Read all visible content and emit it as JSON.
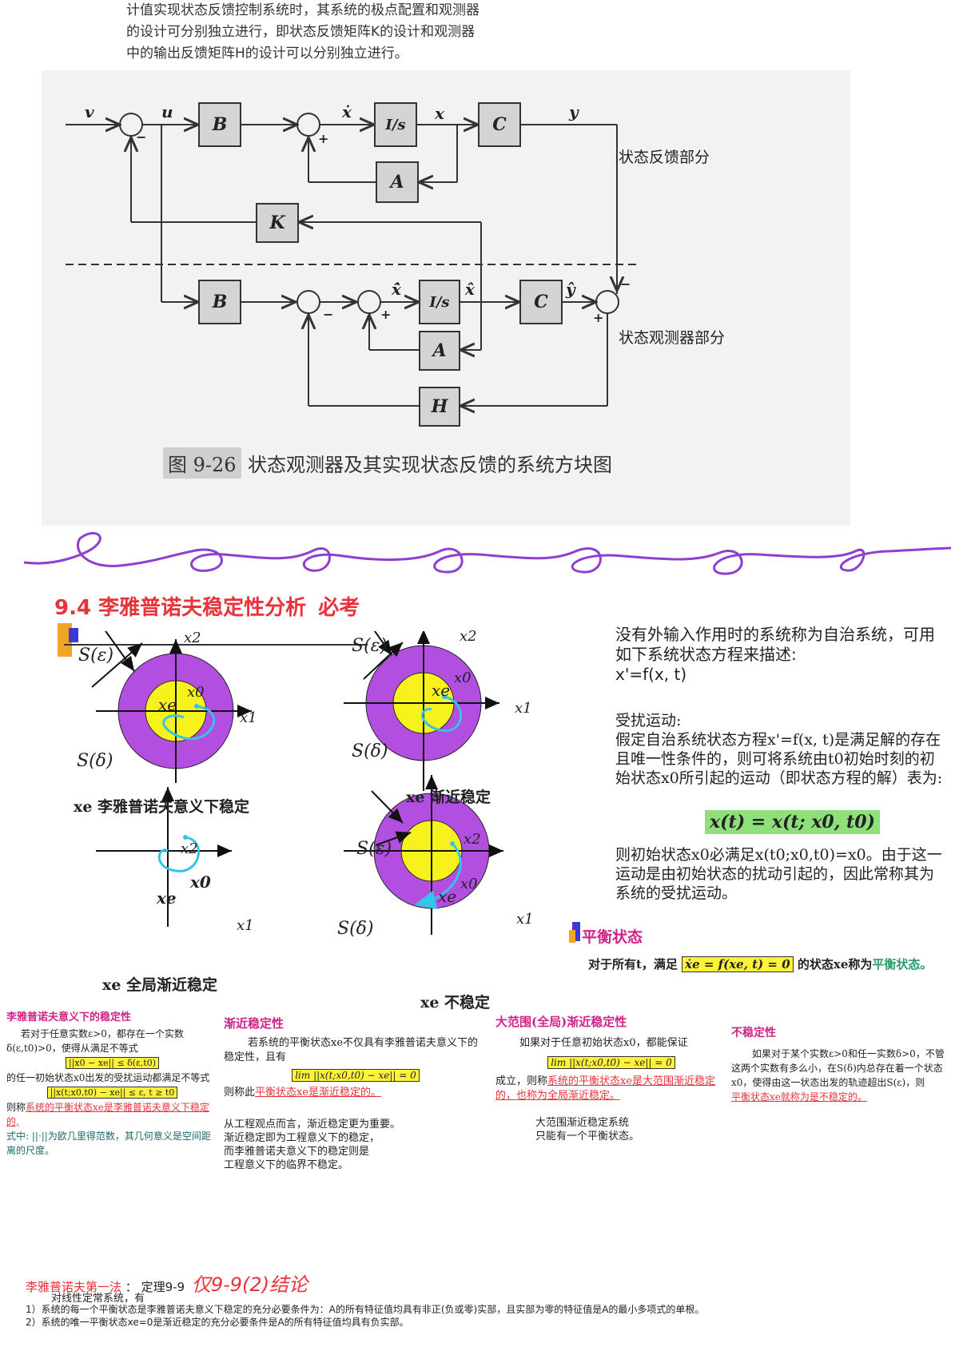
{
  "intro_lines": [
    "计值实现状态反馈控制系统时，其系统的极点配置和观测器",
    "的设计可分别独立进行，即状态反馈矩阵K的设计和观测器",
    "中的输出反馈矩阵H的设计可以分别独立进行。"
  ],
  "diagram": {
    "blocks": {
      "B1": "B",
      "I1": "I/s",
      "C1": "C",
      "A1": "A",
      "K": "K",
      "B2": "B",
      "I2": "I/s",
      "C2": "C",
      "A2": "A",
      "H": "H"
    },
    "signals": {
      "v": "v",
      "u": "u",
      "xdot": "ẋ",
      "x": "x",
      "y": "y",
      "xhatdot": "x̂̇",
      "xhat": "x̂",
      "yhat": "ŷ"
    },
    "signs": {
      "minus": "−",
      "plus": "+"
    },
    "region_feedback": "状态反馈部分",
    "region_observer": "状态观测器部分",
    "caption_num": "图 9-26",
    "caption_text": "状态观测器及其实现状态反馈的系统方块图"
  },
  "section_title": "9.4 李雅普诺夫稳定性分析",
  "section_note": "必考",
  "plots": {
    "s_eps": "S(ε)",
    "s_delta": "S(δ)",
    "x1": "x1",
    "x2": "x2",
    "xe": "xe",
    "x0": "x0",
    "cap1": "xe 李雅普诺夫意义下稳定",
    "cap2": "xe 渐近稳定",
    "cap3": "xe 全局渐近稳定",
    "cap4": "xe 不稳定"
  },
  "right_text": {
    "p1": "没有外输入作用时的系统称为自治系统，可用如下系统状态方程来描述:",
    "eq1": "x'=f(x, t)",
    "p2_title": "受扰运动:",
    "p2": "假定自治系统状态方程x'=f(x, t)是满足解的存在且唯一性条件的，则可将系统由t0初始时刻的初始状态x0所引起的运动（即状态方程的解）表为:",
    "eq2": "x(t) = x(t; x0, t0)",
    "p3": "则初始状态x0必满足x(t0;x0,t0)=x0。由于这一运动是由初始状态的扰动引起的，因此常称其为系统的受扰运动。"
  },
  "equilibrium": {
    "title": "平衡状态",
    "pre": "对于所有t，满足",
    "eq": "ẋe = f(xe, t) = 0",
    "post": "的状态xe称为",
    "term": "平衡状态。"
  },
  "boxes": {
    "b1_title": "李雅普诺夫意义下的稳定性",
    "b1_l1": "若对于任意实数ε>0，都存在一个实数δ(ε,t0)>0，使得从满足不等式",
    "b1_eq1": "||x0 − xe|| ≤ δ(ε,t0)",
    "b1_l2": "的任一初始状态x0出发的受扰运动都满足不等式",
    "b1_eq2": "||x(t;x0,t0) − xe|| ≤ ε,     t ≥ t0",
    "b1_l3a": "则称",
    "b1_l3b": "系统的平衡状态xe是李雅普诺夫意义下稳定的,",
    "b1_l4": "式中: ||·||为欧几里得范数，其几何意义是空间距离的尺度。",
    "b2_title": "渐近稳定性",
    "b2_l1": "若系统的平衡状态xe不仅具有李雅普诺夫意义下的稳定性，且有",
    "b2_eq": "lim ||x(t;x0,t0) − xe|| = 0",
    "b2_l2a": "则称此",
    "b2_l2b": "平衡状态xe是渐近稳定的。",
    "b2_note1": "从工程观点而言，渐近稳定更为重要。",
    "b2_note2": "渐近稳定即为工程意义下的稳定，",
    "b2_note3": "而李雅普诺夫意义下的稳定则是",
    "b2_note4": "工程意义下的临界不稳定。",
    "b3_title": "大范围(全局)渐近稳定性",
    "b3_l1": "如果对于任意初始状态x0，都能保证",
    "b3_eq": "lim ||x(t;x0,t0) − xe|| = 0",
    "b3_l2a": "成立，则称",
    "b3_l2b": "系统的平衡状态xe是大范围渐近稳定的，也称为全局渐近稳定。",
    "b3_note1": "大范围渐近稳定系统",
    "b3_note2": "只能有一个平衡状态。",
    "b4_title": "不稳定性",
    "b4_l1": "如果对于某个实数ε>0和任一实数δ>0，不管这两个实数有多么小，在S(δ)内总存在着一个状态x0，使得由这一状态出发的轨迹超出S(ε)，则",
    "b4_l2": "平衡状态xe就称为是不稳定的。"
  },
  "bottom": {
    "title": "李雅普诺夫第一法",
    "thm": "：  定理9-9",
    "hand": "仅9-9(2)结论",
    "l1": "对线性定常系统，有",
    "l2": "1）系统的每一个平衡状态是李雅普诺夫意义下稳定的充分必要条件为：A的所有特征值均具有非正(负或零)实部，且实部为零的特征值是A的最小多项式的单根。",
    "l3": "2）系统的唯一平衡状态xe=0是渐近稳定的充分必要条件是A的所有特征值均具有负实部。"
  }
}
